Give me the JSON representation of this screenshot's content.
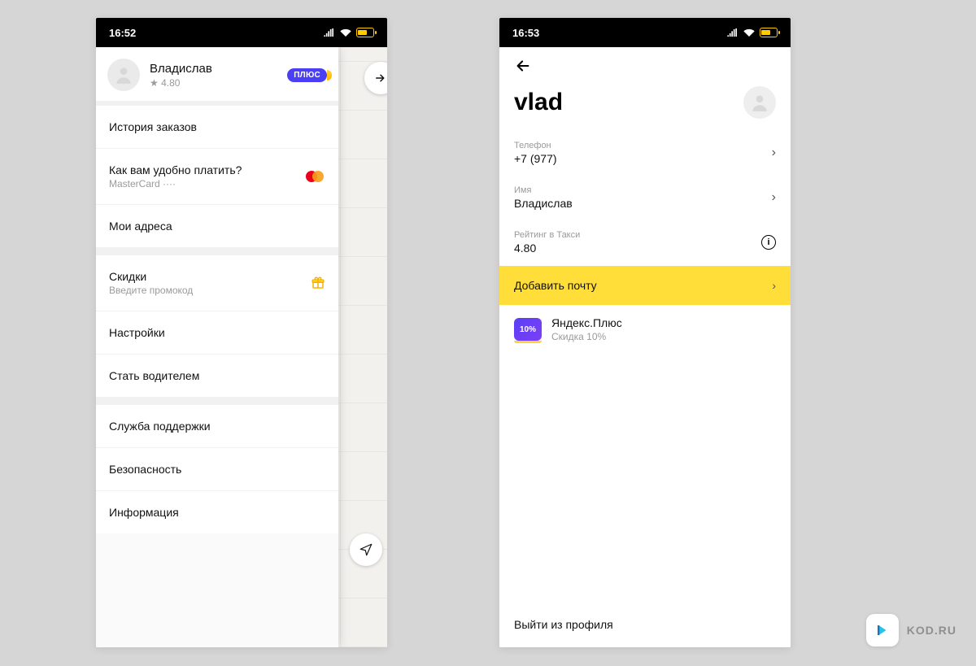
{
  "phone1": {
    "statusbar": {
      "time": "16:52"
    },
    "profile": {
      "name": "Владислав",
      "rating": "★ 4.80",
      "plus_badge": "ПЛЮС"
    },
    "menu": {
      "history": "История заказов",
      "payment_title": "Как вам удобно платить?",
      "payment_sub": "MasterCard ····",
      "addresses": "Мои адреса",
      "discounts_title": "Скидки",
      "discounts_sub": "Введите промокод",
      "settings": "Настройки",
      "become_driver": "Стать водителем",
      "support": "Служба поддержки",
      "security": "Безопасность",
      "info": "Информация"
    }
  },
  "phone2": {
    "statusbar": {
      "time": "16:53"
    },
    "title": "vlad",
    "fields": {
      "phone_label": "Телефон",
      "phone_value": "+7 (977)",
      "name_label": "Имя",
      "name_value": "Владислав",
      "rating_label": "Рейтинг в Такси",
      "rating_value": "4.80"
    },
    "add_email": "Добавить почту",
    "promo": {
      "badge": "10%",
      "title": "Яндекс.Плюс",
      "sub": "Скидка 10%"
    },
    "logout": "Выйти из профиля"
  },
  "brand": {
    "text": "KOD.RU"
  }
}
